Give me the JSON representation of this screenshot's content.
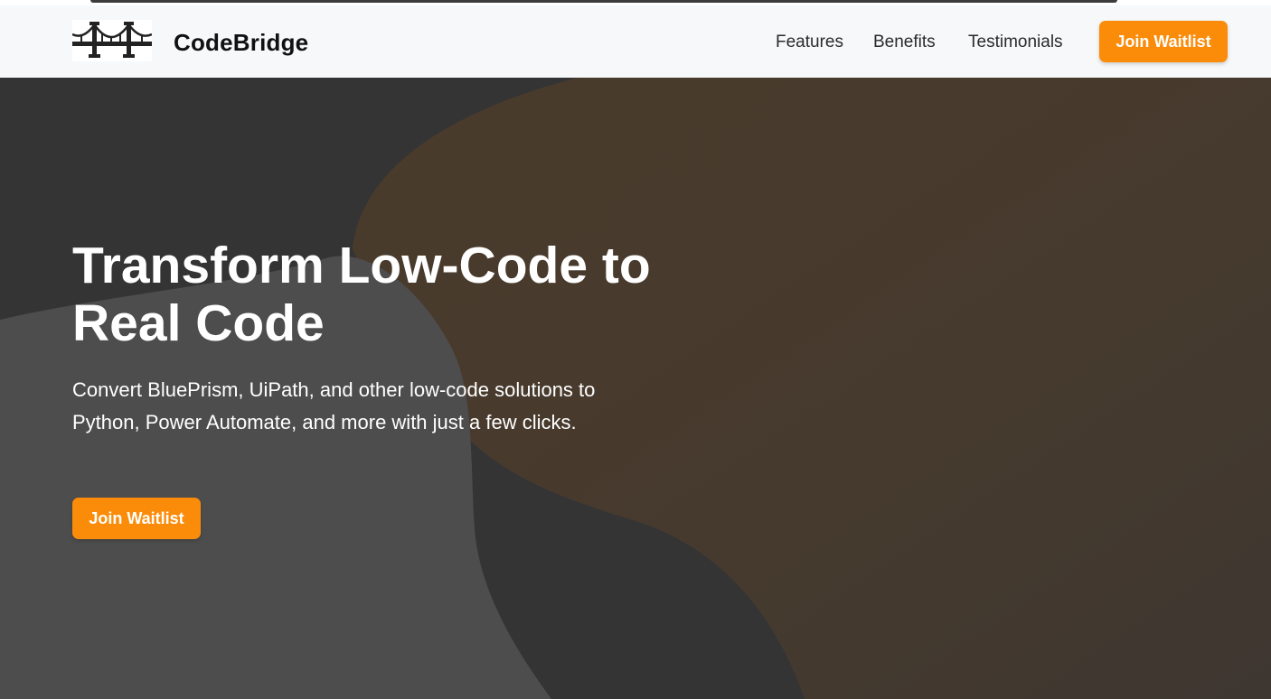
{
  "brand": {
    "name": "CodeBridge",
    "logo_icon": "bridge-icon"
  },
  "nav": {
    "links": [
      "Features",
      "Benefits",
      "Testimonials"
    ],
    "cta_label": "Join Waitlist"
  },
  "hero": {
    "title": "Transform Low-Code to Real Code",
    "subtitle": "Convert BluePrism, UiPath, and other low-code solutions to Python, Power Automate, and more with just a few clicks.",
    "cta_label": "Join Waitlist"
  },
  "colors": {
    "accent": "#fb8c0a",
    "navbar_bg": "#f7f8fa",
    "hero_bg": "#343434",
    "hero_blob_warm": "#4a3b2b",
    "hero_blob_light": "#4d4d4d"
  }
}
